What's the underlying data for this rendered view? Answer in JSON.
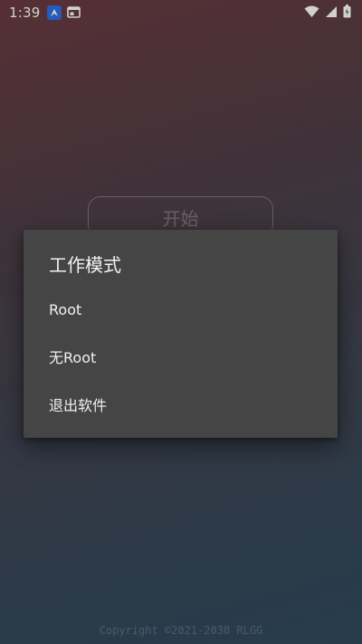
{
  "status_bar": {
    "time": "1:39",
    "icons": [
      "app-notification-icon",
      "window-icon",
      "wifi-icon",
      "cell-signal-icon",
      "battery-icon"
    ]
  },
  "main": {
    "start_label": "开始"
  },
  "dialog": {
    "title": "工作模式",
    "items": [
      {
        "label": "Root"
      },
      {
        "label": "无Root"
      },
      {
        "label": "退出软件"
      }
    ]
  },
  "footer": {
    "copyright": "Copyright ©2021-2030 RLGG"
  },
  "colors": {
    "dialog_bg": "#454545",
    "background_top": "#6a3a40",
    "background_bottom": "#2f4a5f",
    "notif_icon": "#2f6fe8"
  }
}
